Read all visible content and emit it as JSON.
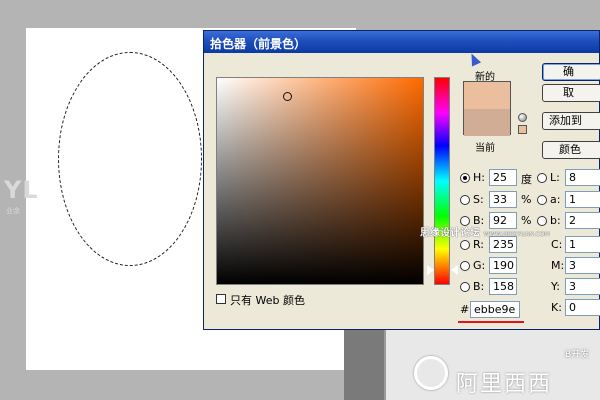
{
  "dialog": {
    "title": "拾色器（前景色）",
    "new_label": "新的",
    "current_label": "当前",
    "buttons": [
      "确",
      "取",
      "添加到",
      "颜色"
    ],
    "web_only_label": "只有 Web 颜色",
    "hash": "#",
    "hex_value": "ebbe9e",
    "new_color": "#ebbe9e",
    "current_color": "#d2ad95"
  },
  "fields": {
    "hsb": [
      {
        "label": "H:",
        "value": "25",
        "unit": "度",
        "selected": true
      },
      {
        "label": "S:",
        "value": "33",
        "unit": "%",
        "selected": false
      },
      {
        "label": "B:",
        "value": "92",
        "unit": "%",
        "selected": false
      }
    ],
    "rgb": [
      {
        "label": "R:",
        "value": "235"
      },
      {
        "label": "G:",
        "value": "190"
      },
      {
        "label": "B:",
        "value": "158"
      }
    ],
    "lab": [
      {
        "label": "L:",
        "value": "8"
      },
      {
        "label": "a:",
        "value": "1"
      },
      {
        "label": "b:",
        "value": "2"
      }
    ],
    "cmyk": [
      {
        "label": "C:",
        "value": "1"
      },
      {
        "label": "M:",
        "value": "3"
      },
      {
        "label": "Y:",
        "value": "3"
      },
      {
        "label": "K:",
        "value": "0"
      }
    ]
  },
  "watermarks": {
    "left": "YL",
    "left_sub": "业余",
    "center": "思缘设计论坛",
    "center_url": "WWW.MISSYUAN.COM",
    "bottom_right": "阿里西西",
    "bottom_right_small": "B开发"
  }
}
